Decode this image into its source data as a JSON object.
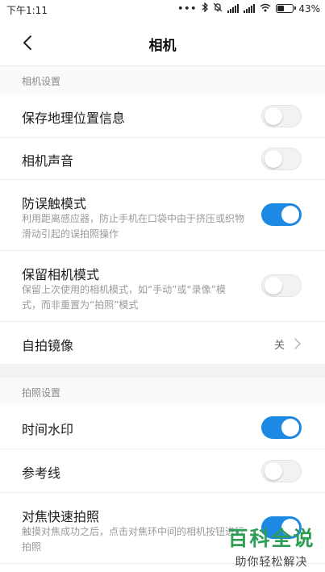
{
  "status_bar": {
    "time": "下午1:11",
    "battery": "43%",
    "icons": [
      "dots-icon",
      "bluetooth-icon",
      "mute-icon",
      "signal-icon",
      "signal-icon",
      "wifi-icon",
      "battery-icon"
    ]
  },
  "header": {
    "title": "相机",
    "back_icon": "chevron-left-icon"
  },
  "sections": [
    {
      "header": "相机设置",
      "items": [
        {
          "label": "保存地理位置信息",
          "type": "toggle",
          "state": "off"
        },
        {
          "label": "相机声音",
          "type": "toggle",
          "state": "off"
        },
        {
          "label": "防误触模式",
          "desc": "利用距离感应器，防止手机在口袋中由于挤压或织物滑动引起的误拍照操作",
          "type": "toggle",
          "state": "on"
        },
        {
          "label": "保留相机模式",
          "desc": "保留上次使用的相机模式，如“手动”或“录像”模式，而非重置为“拍照”模式",
          "type": "toggle",
          "state": "off"
        },
        {
          "label": "自拍镜像",
          "type": "select",
          "value": "关"
        }
      ]
    },
    {
      "header": "拍照设置",
      "items": [
        {
          "label": "时间水印",
          "type": "toggle",
          "state": "on"
        },
        {
          "label": "参考线",
          "type": "toggle",
          "state": "off"
        },
        {
          "label": "对焦快速拍照",
          "desc": "触摸对焦成功之后，点击对焦环中间的相机按钮进行拍照",
          "type": "toggle",
          "state": "on"
        }
      ]
    }
  ],
  "watermark": {
    "main": "百科全说",
    "sub": "助你轻松解决"
  },
  "colors": {
    "accent": "#1e88e5",
    "watermark": "#2e9e56"
  }
}
